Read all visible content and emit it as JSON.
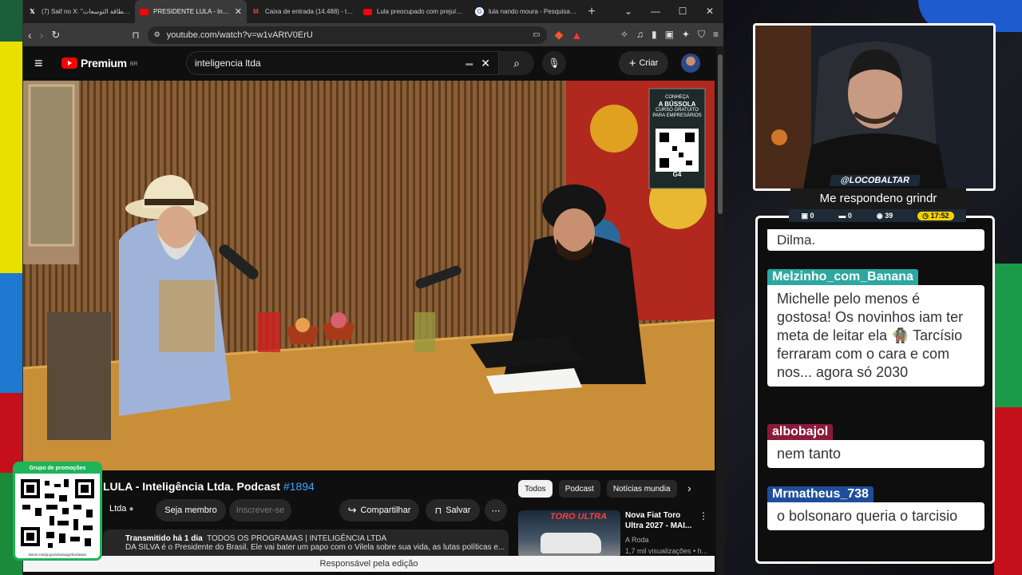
{
  "browser": {
    "tabs": [
      {
        "label": "(7) Saif no X: \"بطاقة التوسعات ...",
        "icon": "x-icon",
        "active": false
      },
      {
        "label": "PRESIDENTE LULA - Inteligê...",
        "icon": "youtube-icon",
        "active": true
      },
      {
        "label": "Caixa de entrada (14.488) - theb...",
        "icon": "gmail-icon",
        "active": false
      },
      {
        "label": "Lula preocupado com prejuízo e...",
        "icon": "youtube-icon",
        "active": false
      },
      {
        "label": "lula nando moura - Pesquisa Go...",
        "icon": "google-icon",
        "active": false
      }
    ],
    "url": "youtube.com/watch?v=w1vARtV0ErU"
  },
  "youtube": {
    "logo": "Premium",
    "region": "BR",
    "search_value": "inteligencia ltda",
    "create_label": "Criar",
    "video_title": "LULA - Inteligência Ltda. Podcast ",
    "video_hashtag": "#1894",
    "channel": "Ltda",
    "member_button": "Seja membro",
    "subscribe_button": "Inscrever-se",
    "share_button": "Compartilhar",
    "save_button": "Salvar",
    "desc_meta": "Transmitido há 1 dia",
    "desc_tags": "TODOS OS PROGRAMAS | INTELIGÊNCIA LTDA",
    "desc_text": "DA SILVA é o Presidente do Brasil. Ele vai bater um papo com o Vilela sobre sua vida, as lutas políticas e...",
    "chips": [
      "Todos",
      "Podcast",
      "Notícias mundia"
    ],
    "rec": {
      "title": "Nova Fiat Toro Ultra 2027 - MAI...",
      "channel": "A Roda",
      "meta": "1,7 mil visualizações • h...",
      "thumb_text": "TORO ULTRA"
    },
    "edit_bar": "Responsável pela edição"
  },
  "overlay": {
    "promo_header": "Grupo de promoções",
    "promo_url": "itstore.net/grupo/whatsapp/hardware",
    "ad_lines": [
      "CONHEÇA",
      "A BÚSSOLA",
      "CURSO GRATUITO",
      "PARA EMPRESÁRIOS",
      "G4"
    ]
  },
  "stream": {
    "handle": "@LOCOBALTAR",
    "caption": "Me respondeno grindr",
    "stats": {
      "a": "0",
      "b": "0",
      "viewers": "39",
      "time": "17:52"
    }
  },
  "chat": {
    "messages": [
      {
        "user": "",
        "text": "Dilma.",
        "color": "#2ca8a0"
      },
      {
        "user": "Melzinho_com_Banana",
        "text": "Michelle pelo menos é gostosa! Os novinhos iam ter meta de leitar ela 🧌 Tarcísio ferraram com o cara e com nos... agora só 2030",
        "color": "#2ca8a0"
      },
      {
        "user": "albobajol",
        "text": "nem tanto",
        "color": "#8a1a3a"
      },
      {
        "user": "Mrmatheus_738",
        "text": "o bolsonaro queria o tarcisio",
        "color": "#1e4e9a"
      }
    ]
  }
}
